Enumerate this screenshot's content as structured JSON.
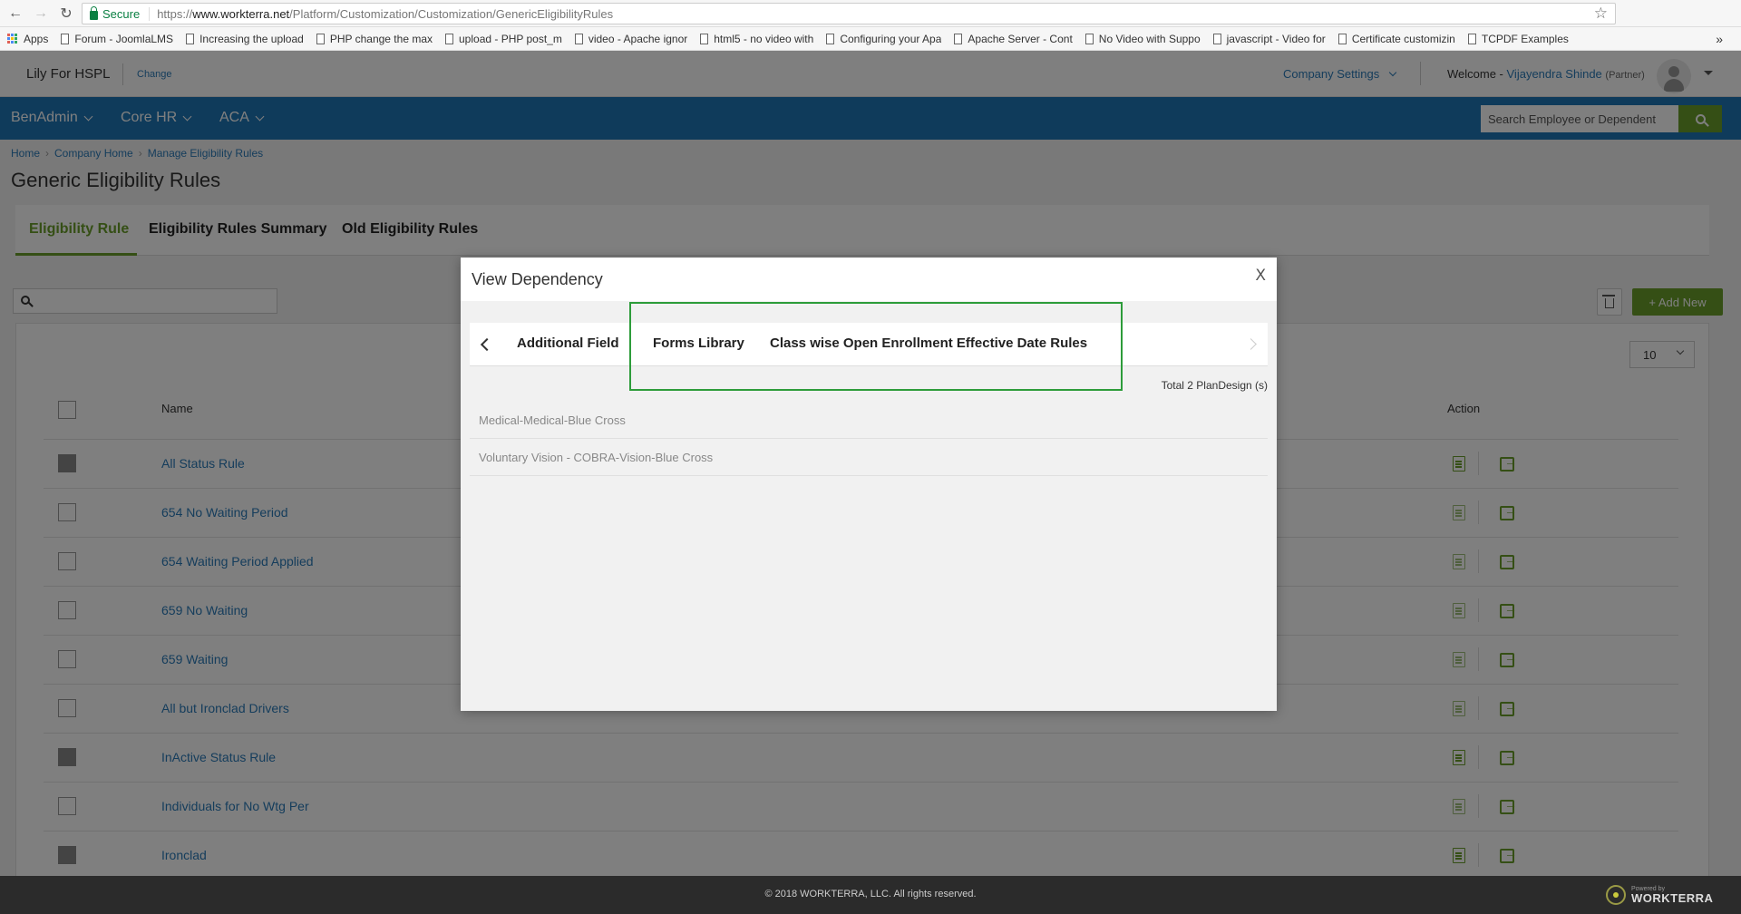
{
  "browser": {
    "secure_label": "Secure",
    "url_scheme": "https://",
    "url_host": "www.workterra.net",
    "url_path": "/Platform/Customization/Customization/GenericEligibilityRules",
    "bookmarks": [
      "Apps",
      "Forum - JoomlaLMS",
      "Increasing the upload",
      "PHP change the max",
      "upload - PHP post_m",
      "video - Apache ignor",
      "html5 - no video with",
      "Configuring your Apa",
      "Apache Server - Cont",
      "No Video with Suppo",
      "javascript - Video for",
      "Certificate customizin",
      "TCPDF Examples"
    ],
    "bookmarks_more": "»"
  },
  "header": {
    "company_name": "Lily For HSPL",
    "change_label": "Change",
    "company_settings_label": "Company Settings",
    "welcome_label": "Welcome - ",
    "user_name": "Vijayendra Shinde",
    "user_role": "(Partner)"
  },
  "nav": {
    "items": [
      "BenAdmin",
      "Core HR",
      "ACA"
    ],
    "search_placeholder": "Search Employee or Dependent"
  },
  "breadcrumb": [
    "Home",
    "Company Home",
    "Manage Eligibility Rules"
  ],
  "page_title": "Generic Eligibility Rules",
  "tabs": [
    "Eligibility Rule",
    "Eligibility Rules Summary",
    "Old Eligibility Rules"
  ],
  "active_tab": "Eligibility Rule",
  "toolbar": {
    "add_new_label": "+ Add New",
    "page_size": "10"
  },
  "table": {
    "columns": [
      "Name",
      "Action"
    ],
    "rows": [
      {
        "name": "All Status Rule",
        "disabled": true
      },
      {
        "name": "654 No Waiting Period",
        "disabled": false
      },
      {
        "name": "654 Waiting Period Applied",
        "disabled": false
      },
      {
        "name": "659 No Waiting",
        "disabled": false
      },
      {
        "name": "659 Waiting",
        "disabled": false
      },
      {
        "name": "All but Ironclad Drivers",
        "disabled": false
      },
      {
        "name": "InActive Status Rule",
        "disabled": true
      },
      {
        "name": "Individuals for No Wtg Per",
        "disabled": false
      },
      {
        "name": "Ironclad",
        "disabled": true
      }
    ]
  },
  "modal": {
    "title": "View Dependency",
    "close_label": "X",
    "tabs": [
      "Additional Field",
      "Forms Library",
      "Class wise Open Enrollment Effective Date Rules"
    ],
    "total_label": "Total 2 PlanDesign (s)",
    "items": [
      "Medical-Medical-Blue Cross",
      "Voluntary Vision - COBRA-Vision-Blue Cross"
    ]
  },
  "footer": {
    "copyright": "© 2018 WORKTERRA, LLC. All rights reserved.",
    "powered_by": "Powered by",
    "brand": "WORKTERRA"
  },
  "colors": {
    "nav_blue": "#1f77b7",
    "accent_green": "#6a9e2a",
    "link_blue": "#2a7ab8",
    "highlight_green": "#2d9c3a"
  }
}
